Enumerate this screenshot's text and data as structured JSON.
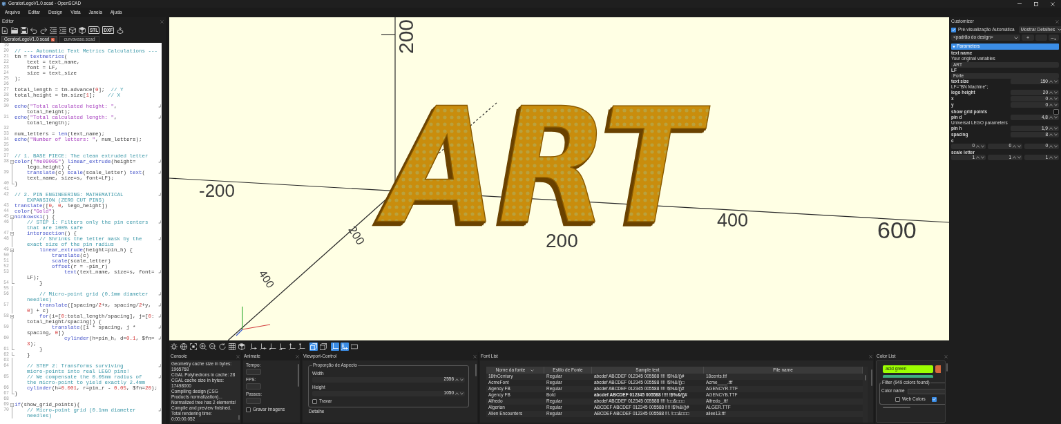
{
  "window": {
    "title": "GeratorLegoV1.0.scad - OpenSCAD"
  },
  "menu": [
    "Arquivo",
    "Editar",
    "Design",
    "Vista",
    "Janela",
    "Ajuda"
  ],
  "editor": {
    "title": "Editor",
    "toolbar": [
      {
        "kind": "new"
      },
      {
        "kind": "open"
      },
      {
        "kind": "save"
      },
      {
        "kind": "undo"
      },
      {
        "kind": "redo"
      },
      {
        "kind": "unindent"
      },
      {
        "kind": "indent"
      },
      {
        "kind": "preview"
      },
      {
        "kind": "render"
      },
      {
        "kind": "export",
        "label": "STL"
      },
      {
        "kind": "export",
        "label": "DXF"
      },
      {
        "kind": "send"
      }
    ],
    "tabs": [
      {
        "label": "GeratorLegoV1.0.scad",
        "selected": true
      },
      {
        "label": "curvavaso.scad",
        "selected": false
      }
    ],
    "lines": [
      {
        "number": "19",
        "kind": "plain"
      },
      {
        "number": "20",
        "kind": "plain",
        "text": "// --- Automatic Text Metrics Calculations ---"
      },
      {
        "number": "21",
        "kind": "plain",
        "text": "tm = textmetrics("
      },
      {
        "number": "22",
        "kind": "plain",
        "text": "    text = text_name,"
      },
      {
        "number": "23",
        "kind": "plain",
        "text": "    font = LF,"
      },
      {
        "number": "24",
        "kind": "plain",
        "text": "    size = text_size"
      },
      {
        "number": "25",
        "kind": "plain",
        "text": ");"
      },
      {
        "number": "26",
        "kind": "plain"
      },
      {
        "number": "27",
        "kind": "plain",
        "text": "total_length = tm.advance[0];  // Y"
      },
      {
        "number": "28",
        "kind": "plain",
        "text": "total_height = tm.size[1];    // X"
      },
      {
        "number": "29",
        "kind": "plain"
      },
      {
        "number": "30",
        "kind": "plain",
        "text": "echo(\"Total calculated height: \",",
        "wrapped": "total_height);"
      },
      {
        "number": "31",
        "kind": "plain",
        "text": "echo(\"Total calculated length: \",",
        "wrapped": "total_length);"
      },
      {
        "number": "32",
        "kind": "plain"
      },
      {
        "number": "33",
        "kind": "plain",
        "text": "num_letters = len(text_name);"
      },
      {
        "number": "34",
        "kind": "plain",
        "text": "echo(\"Number of letters: \", num_letters);"
      },
      {
        "number": "35",
        "kind": "plain"
      },
      {
        "number": "36",
        "kind": "plain"
      },
      {
        "number": "37",
        "kind": "plain",
        "text": "// 1. BASE PIECE: The clean extruded letter"
      },
      {
        "number": "38",
        "kind": "foldstart",
        "text": "color(\"#e09005\") linear_extrude(height=",
        "wrapped": "lego_height) {"
      },
      {
        "number": "39",
        "kind": "foldbody",
        "text": "    translate(c) scale(scale_letter) text(",
        "wrapped": "text_name, size=s, font=LF);"
      },
      {
        "number": "40",
        "kind": "foldend",
        "text": "}"
      },
      {
        "number": "41",
        "kind": "plain"
      },
      {
        "number": "42",
        "kind": "plain",
        "text": "// 2. PIN ENGINEERING: MATHEMATICAL",
        "wrapped": "EXPANSION (ZERO CUT PINS)"
      },
      {
        "number": "43",
        "kind": "plain",
        "text": "translate([0, 0, lego_height])"
      },
      {
        "number": "44",
        "kind": "plain",
        "text": "color(\"Gold\")"
      },
      {
        "number": "45",
        "kind": "foldstart",
        "text": "minkowski() {"
      },
      {
        "number": "46",
        "kind": "foldbody",
        "text": "    // STEP 1: Filters only the pin centers",
        "wrapped": "that are 100% safe"
      },
      {
        "number": "47",
        "kind": "foldstart",
        "text": "    intersection() {"
      },
      {
        "number": "48",
        "kind": "foldbody",
        "text": "        // Shrinks the letter mask by the",
        "wrapped": "exact size of the pin radius"
      },
      {
        "number": "49",
        "kind": "foldstart",
        "text": "        linear_extrude(height=pin_h) {"
      },
      {
        "number": "50",
        "kind": "foldbody",
        "text": "            translate(c)"
      },
      {
        "number": "51",
        "kind": "foldbody",
        "text": "            scale(scale_letter)"
      },
      {
        "number": "52",
        "kind": "foldbody",
        "text": "            offset(r = -pin_r)"
      },
      {
        "number": "53",
        "kind": "foldbody",
        "text": "                text(text_name, size=s, font=",
        "wrapped": "LF);"
      },
      {
        "number": "54",
        "kind": "foldend",
        "text": "        }"
      },
      {
        "number": "55",
        "kind": "foldbody"
      },
      {
        "number": "56",
        "kind": "foldbody",
        "text": "        // Micro-point grid (0.1mm diameter",
        "wrapped": "needles)"
      },
      {
        "number": "57",
        "kind": "foldbody",
        "text": "        translate([spacing/2+x, spacing/2+y,",
        "wrapped": "0] + c)"
      },
      {
        "number": "58",
        "kind": "foldstart",
        "text": "        for(i=[0:total_length/spacing], j=[0:",
        "wrapped": "total_height/spacing]) {"
      },
      {
        "number": "59",
        "kind": "foldbody",
        "text": "            translate([i * spacing, j *",
        "wrapped": "spacing, 0])"
      },
      {
        "number": "60",
        "kind": "foldbody",
        "text": "                cylinder(h=pin_h, d=0.1, $fn=",
        "wrapped": "3);"
      },
      {
        "number": "61",
        "kind": "foldend",
        "text": "        }"
      },
      {
        "number": "62",
        "kind": "foldend",
        "text": "    }"
      },
      {
        "number": "63",
        "kind": "foldbody"
      },
      {
        "number": "64",
        "kind": "foldbody",
        "text": "    // STEP 2: Transforms surviving",
        "wrapped": "micro-points into real LEGO pins!"
      },
      {
        "number": "65",
        "kind": "foldbody",
        "text": "    // We compensate the 0.05mm radius of",
        "wrapped": "the micro-point to yield exactly 2.4mm"
      },
      {
        "number": "66",
        "kind": "foldbody",
        "text": "    cylinder(h=0.001, r=pin_r - 0.05, $fn=20);"
      },
      {
        "number": "67",
        "kind": "foldend",
        "text": "}"
      },
      {
        "number": "68",
        "kind": "plain"
      },
      {
        "number": "69",
        "kind": "foldstart",
        "text": "if(show_grid_points){"
      },
      {
        "number": "70",
        "kind": "foldbody",
        "text": "    // Micro-point grid (0.1mm diameter",
        "wrapped": "needles)"
      }
    ]
  },
  "viewport": {
    "axes": {
      "x": {
        "labels": [
          "-200",
          "200",
          "400",
          "600"
        ]
      },
      "y": {
        "labels": [
          "200",
          "400"
        ]
      },
      "z": {
        "labels": [
          "200"
        ]
      }
    },
    "model": {
      "text": "ART"
    },
    "toolbar": [
      [
        {
          "kind": "gear",
          "selected": false
        },
        {
          "kind": "globe",
          "selected": false
        },
        {
          "kind": "frame",
          "selected": false
        },
        {
          "kind": "zoom_in",
          "selected": false
        },
        {
          "kind": "zoom_out",
          "selected": false
        },
        {
          "kind": "rotate",
          "selected": false
        },
        {
          "kind": "grid",
          "selected": false
        },
        {
          "kind": "shaded_cube",
          "selected": false
        }
      ],
      [
        {
          "kind": "view_right",
          "selected": false
        },
        {
          "kind": "view_left",
          "selected": false
        },
        {
          "kind": "view_front",
          "selected": false
        },
        {
          "kind": "view_back",
          "selected": false
        },
        {
          "kind": "view_top",
          "selected": false
        },
        {
          "kind": "view_bottom",
          "selected": false
        }
      ],
      [
        {
          "kind": "perspective",
          "selected": true
        },
        {
          "kind": "orthogonal",
          "selected": false
        }
      ],
      [
        {
          "kind": "axes",
          "selected": true
        },
        {
          "kind": "scale_marks",
          "selected": true
        },
        {
          "kind": "crosshairs",
          "selected": false
        }
      ]
    ]
  },
  "console": {
    "title": "Console",
    "lines": [
      "Geometry cache size in bytes:",
      "1965768",
      "CGAL Polyhedrons in cache: 28",
      "CGAL cache size in bytes:",
      "17498000",
      "Compiling design (CSG",
      "Products normalization)...",
      "Normalized tree has 2 elements!",
      "Compile and preview finished.",
      "Total rendering time:",
      "0:00:00.052"
    ]
  },
  "animate": {
    "title": "Animate",
    "fields": [
      {
        "label": "Tempo:"
      },
      {
        "label": "FPS:"
      },
      {
        "label": "Passos:"
      }
    ],
    "record": {
      "label": "Gravar imagens",
      "checked": false
    }
  },
  "viewport_control": {
    "title": "Viewport-Control",
    "group": "Proporção de Aspecto",
    "fields": [
      {
        "label": "Width",
        "value": "2556"
      },
      {
        "label": "Height",
        "value": "1050"
      }
    ],
    "lock": {
      "label": "Travar",
      "checked": false
    },
    "next_group": "Detalhe"
  },
  "font_list": {
    "title": "Font List",
    "columns": [
      {
        "label": "Nome da fonte",
        "sorted": true
      },
      {
        "label": "Estilo de Fonte",
        "sorted": false
      },
      {
        "label": "Sample text",
        "sorted": false
      },
      {
        "label": "File name",
        "sorted": false
      }
    ],
    "rows": [
      [
        "18thCentury",
        "Regular",
        "abcdef ABCDEF 012345 005588 !!!! !$%&/()#",
        "18cents.ttf"
      ],
      [
        "AcmeFont",
        "Regular",
        "abcdef ABCDEF 012345 005588 !!!! !$%&/()□",
        "Acme____.ttf"
      ],
      [
        "Agency FB",
        "Regular",
        "abcdef ABCDEF 012345 005588 !!!! !$%&/()#",
        "AGENCYR.TTF"
      ],
      [
        "Agency FB",
        "Bold",
        "abcdef ABCDEF 012345 005588 !!!! !$%&/()#",
        "AGENCYB.TTF"
      ],
      [
        "Alfredo",
        "Regular",
        "abcdef ABCDEF 012345 005588 !!!! !□□&□□□",
        "Alfredo_.ttf"
      ],
      [
        "Algerian",
        "Regular",
        "ABCDEF ABCDEF 012345 005588 !!!! !$%&/()#",
        "ALGER.TTF"
      ],
      [
        "Alien Encounters",
        "Regular",
        "ABCDEF ABCDEF 012345 005588 !!!. !□□&□□□",
        "aliee13.ttf"
      ]
    ]
  },
  "color_list": {
    "title": "Color List",
    "swatches": [
      {
        "name": "acid green",
        "color": "#9cff00"
      },
      {
        "color": "#d8693c"
      },
      {
        "color": "#3eae80"
      }
    ],
    "filter": {
      "title": "Filter (949 colors found)",
      "name_label": "Color name",
      "options": [
        {
          "label": "Web Colors",
          "checked": false
        },
        {
          "checked": true
        }
      ]
    }
  },
  "customizer": {
    "title": "Customizer",
    "auto_preview": {
      "label": "Pré-visualização Automática",
      "checked": true
    },
    "detail_mode": "Mostrar Detalhes",
    "preset": "<padrão do design>",
    "preset_buttons": [
      {
        "kind": "add",
        "label": "+"
      },
      {
        "kind": "blank"
      },
      {
        "kind": "menu",
        "label": "–"
      }
    ],
    "section": {
      "label": "Parameters",
      "expanded": true
    },
    "parameters": [
      {
        "kind": "text",
        "name": "text name",
        "description": "Your original variables",
        "value": "ART"
      },
      {
        "kind": "text",
        "name": "LF",
        "value": "Forte"
      },
      {
        "kind": "number",
        "name": "text size",
        "description": "LF=\"BN Machine\";",
        "value": "150"
      },
      {
        "kind": "number",
        "name": "lego height",
        "value": "20"
      },
      {
        "kind": "number",
        "name": "x",
        "value": "0"
      },
      {
        "kind": "number",
        "name": "y",
        "value": "0"
      },
      {
        "kind": "checkbox",
        "name": "show grid points",
        "checked": false
      },
      {
        "kind": "number",
        "name": "pin d",
        "description": "Universal LEGO parameters",
        "value": "4,8"
      },
      {
        "kind": "number",
        "name": "pin h",
        "value": "1,9"
      },
      {
        "kind": "number",
        "name": "spacing",
        "value": "8"
      },
      {
        "kind": "vector",
        "name": "c",
        "values": [
          "0",
          "0",
          "0"
        ]
      },
      {
        "kind": "vector",
        "name": "scale letter",
        "values": [
          "1",
          "1",
          "1"
        ]
      }
    ]
  }
}
